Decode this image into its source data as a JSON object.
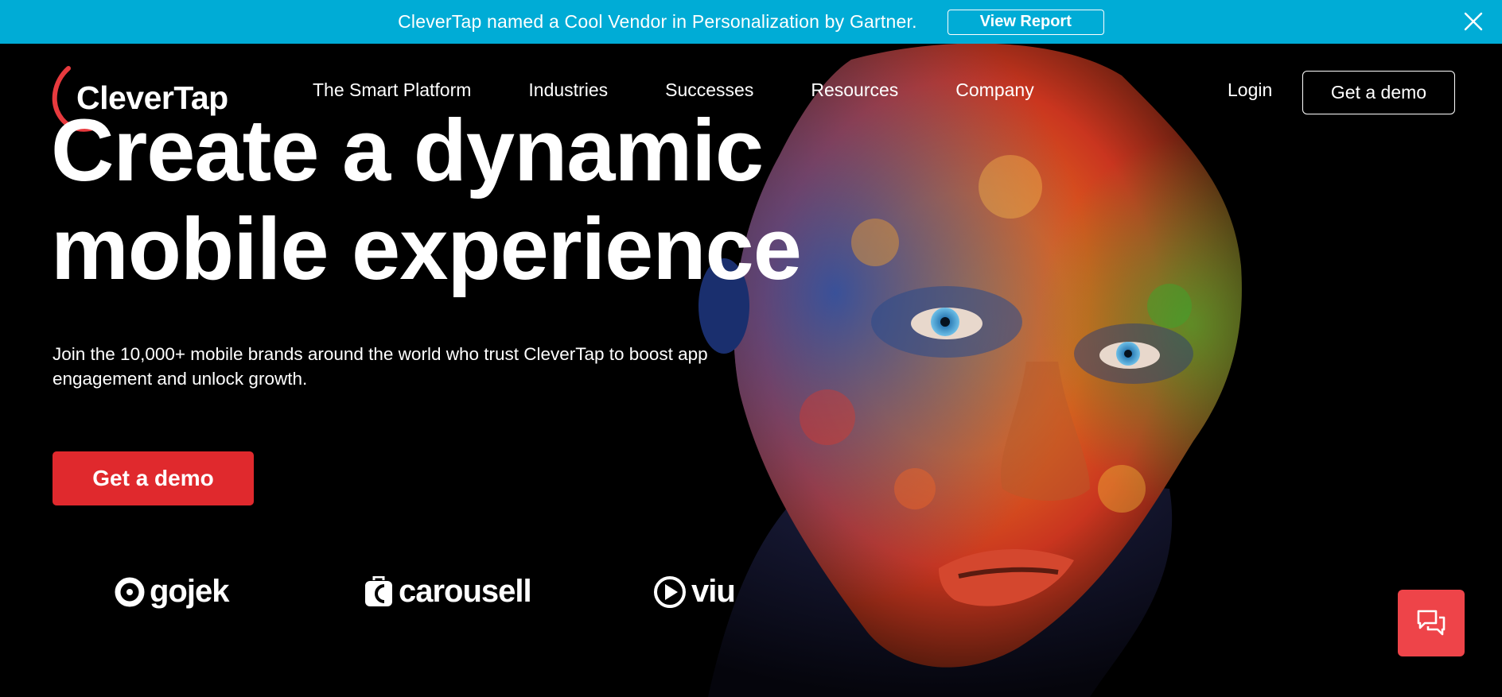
{
  "announcement": {
    "text": "CleverTap named a Cool Vendor in Personalization by Gartner.",
    "button_label": "View Report",
    "close_icon": "close-icon",
    "background": "#00acd6"
  },
  "header": {
    "logo_text": "CleverTap",
    "nav_items": [
      "The Smart Platform",
      "Industries",
      "Successes",
      "Resources",
      "Company"
    ],
    "login_label": "Login",
    "demo_label": "Get a demo"
  },
  "hero": {
    "headline_line1": "Create a dynamic",
    "headline_line2": "mobile experience",
    "subhead": "Join the 10,000+ mobile brands around the world who trust CleverTap to boost app engagement and unlock growth.",
    "cta_label": "Get a demo",
    "cta_color": "#e0292d"
  },
  "brands": [
    {
      "name": "gojek",
      "icon": "gojek-logo-icon"
    },
    {
      "name": "carousell",
      "icon": "carousell-logo-icon"
    },
    {
      "name": "viu",
      "icon": "viu-play-icon"
    }
  ],
  "chat_widget": {
    "icon": "chat-bubbles-icon",
    "color": "#ee4449"
  }
}
